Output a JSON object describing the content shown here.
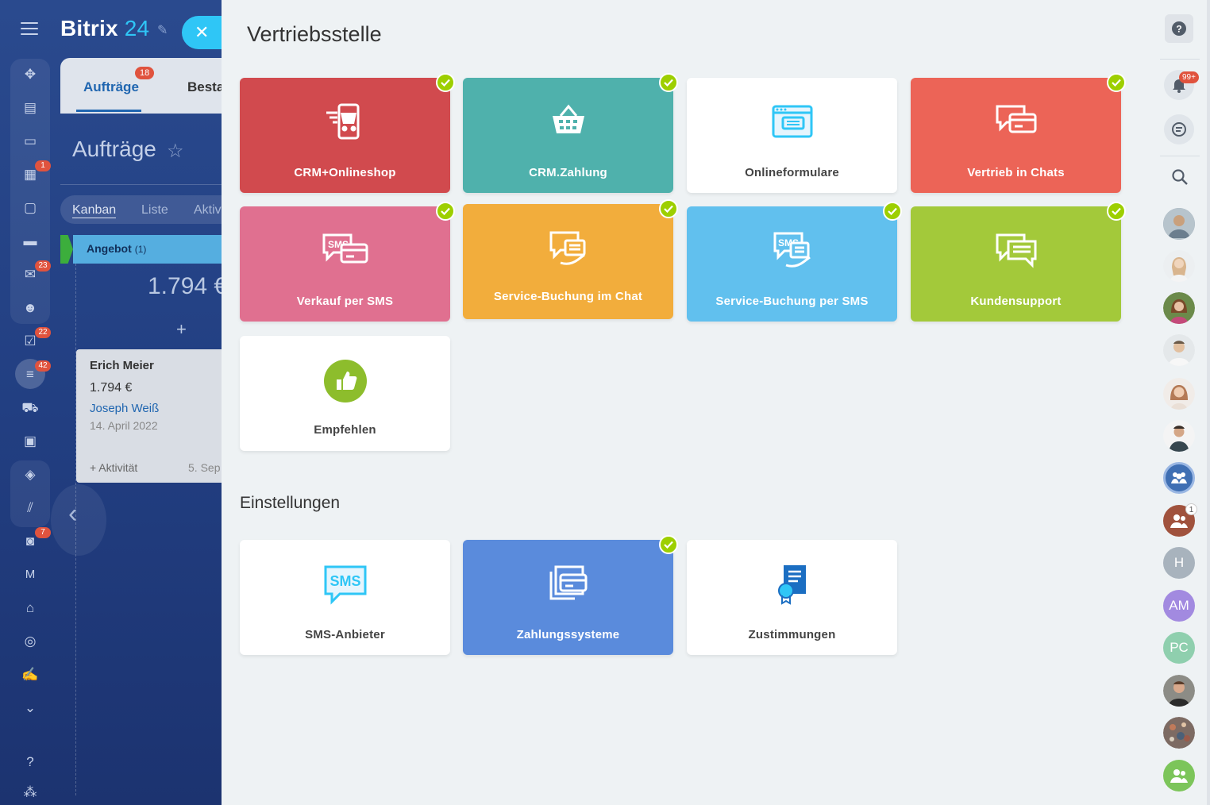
{
  "app": {
    "logo_main": "Bitrix",
    "logo_num": "24",
    "close_glyph": "✕"
  },
  "left_rail": {
    "badges": {
      "calendar": "1",
      "mail": "23",
      "tasks": "22",
      "sales": "42",
      "robots": "7"
    },
    "m_label": "M"
  },
  "background": {
    "tab_orders": "Aufträge",
    "tab_orders_badge": "18",
    "tab_next": "Besta",
    "title": "Aufträge",
    "views": [
      "Kanban",
      "Liste",
      "Aktiv"
    ],
    "stage_name": "Angebot",
    "stage_count": "(1)",
    "stage_sum": "1.794 €",
    "plus": "+",
    "card": {
      "name": "Erich Meier",
      "amount": "1.794 €",
      "contact": "Joseph Weiß",
      "date": "14. April 2022",
      "activity": "+ Aktivität",
      "sep_date": "5. Sep"
    }
  },
  "page": {
    "title": "Vertriebsstelle",
    "tiles": [
      {
        "label": "CRM+Onlineshop",
        "color": "#d14a4e",
        "icon": "cart-phone-icon",
        "checked": true
      },
      {
        "label": "CRM.Zahlung",
        "color": "#4fb1ac",
        "icon": "basket-icon",
        "checked": true
      },
      {
        "label": "Onlineformulare",
        "color": "#ffffff",
        "icon": "web-form-icon",
        "checked": false
      },
      {
        "label": "Vertrieb in Chats",
        "color": "#ec6457",
        "icon": "chat-card-icon",
        "checked": true
      },
      {
        "label": "Verkauf per SMS",
        "color": "#e07090",
        "icon": "sms-card-icon",
        "checked": true
      },
      {
        "label": "Service-Buchung im Chat",
        "color": "#f2ad3c",
        "icon": "chat-hand-icon",
        "checked": true
      },
      {
        "label": "Service-Buchung per SMS",
        "color": "#61c0ee",
        "icon": "sms-hand-icon",
        "checked": true
      },
      {
        "label": "Kundensupport",
        "color": "#a3c93a",
        "icon": "support-chat-icon",
        "checked": true
      },
      {
        "label": "Empfehlen",
        "color": "#ffffff",
        "icon": "thumbs-up-icon",
        "checked": false
      }
    ],
    "settings_heading": "Einstellungen",
    "settings": [
      {
        "label": "SMS-Anbieter",
        "color": "#ffffff",
        "icon": "sms-icon",
        "checked": false,
        "icon_text": "SMS"
      },
      {
        "label": "Zahlungssysteme",
        "color": "#5a8bdc",
        "icon": "payment-systems-icon",
        "checked": true
      },
      {
        "label": "Zustimmungen",
        "color": "#ffffff",
        "icon": "agreement-icon",
        "checked": false
      }
    ]
  },
  "right_rail": {
    "notifications_badge": "99+",
    "avatar_initials": [
      "H",
      "AM",
      "PC"
    ],
    "group_badge": "1"
  }
}
